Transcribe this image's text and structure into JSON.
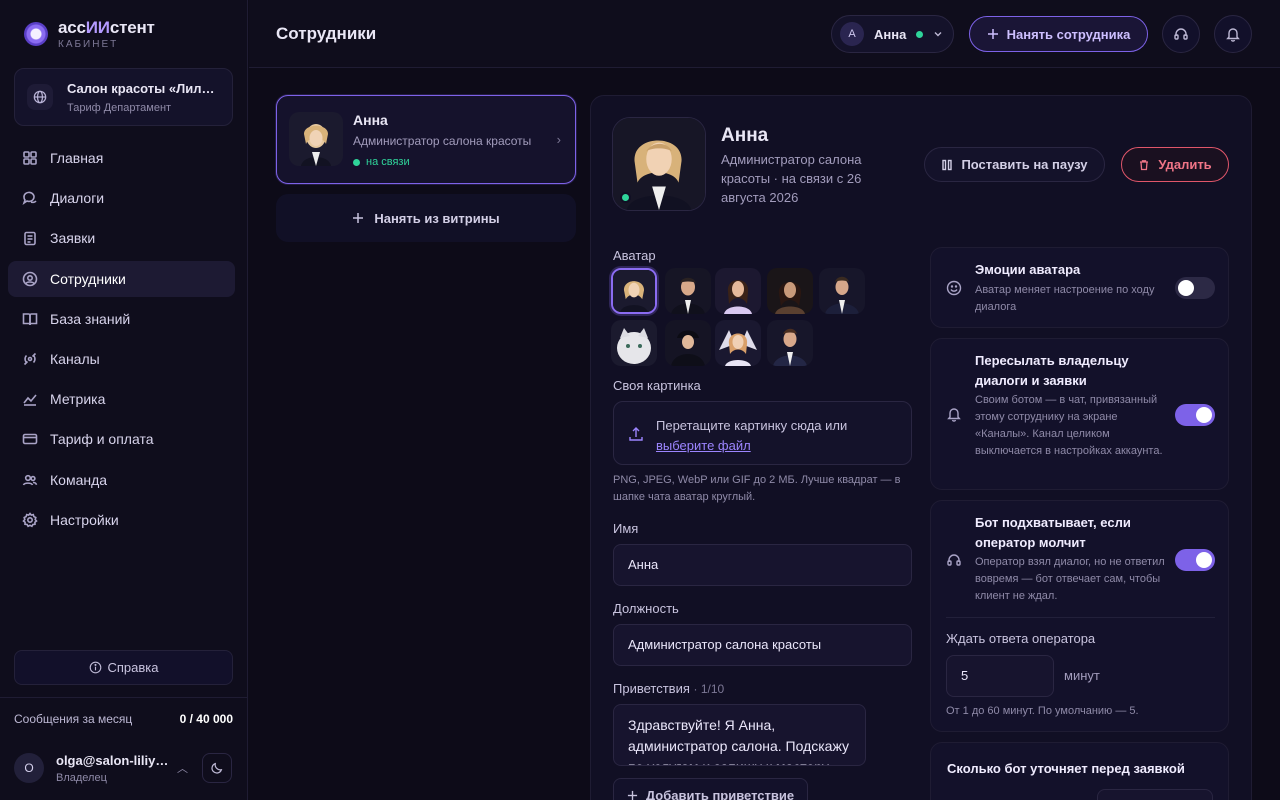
{
  "brand": {
    "name_pre": "асс",
    "name_hl": "ИИ",
    "name_post": "стент",
    "sub": "КАБИНЕТ"
  },
  "org": {
    "title": "Салон красоты «Лилия»",
    "plan": "Тариф Департамент"
  },
  "nav": [
    {
      "label": "Главная",
      "icon": "grid-icon"
    },
    {
      "label": "Диалоги",
      "icon": "chat-icon"
    },
    {
      "label": "Заявки",
      "icon": "clipboard-icon"
    },
    {
      "label": "Сотрудники",
      "icon": "user-circle-icon",
      "active": true
    },
    {
      "label": "База знаний",
      "icon": "book-icon"
    },
    {
      "label": "Каналы",
      "icon": "antenna-icon"
    },
    {
      "label": "Метрика",
      "icon": "chart-icon"
    },
    {
      "label": "Тариф и оплата",
      "icon": "card-icon"
    },
    {
      "label": "Команда",
      "icon": "team-icon"
    },
    {
      "label": "Настройки",
      "icon": "gear-icon"
    }
  ],
  "help_label": "Справка",
  "messages": {
    "label": "Сообщения за месяц",
    "value": "0 / 40 000"
  },
  "user": {
    "initial": "O",
    "email": "olga@salon-liliya.ru",
    "role": "Владелец"
  },
  "header": {
    "title": "Сотрудники",
    "selector": {
      "initial": "А",
      "name": "Анна"
    },
    "hire_label": "Нанять сотрудника"
  },
  "list": {
    "card": {
      "name": "Анна",
      "role": "Администратор салона красоты",
      "status": "на связи"
    },
    "hire_store": "Нанять из витрины"
  },
  "profile": {
    "name": "Анна",
    "subtitle": "Администратор салона красоты · на связи с 26 августа 2026",
    "pause_label": "Поставить на паузу",
    "delete_label": "Удалить"
  },
  "form": {
    "avatar_label": "Аватар",
    "custom_label": "Своя картинка",
    "drop_text": "Перетащите картинку сюда или",
    "drop_link": "выберите файл",
    "drop_hint": "PNG, JPEG, WebP или GIF до 2 МБ. Лучше квадрат — в шапке чата аватар круглый.",
    "name_label": "Имя",
    "name_value": "Анна",
    "position_label": "Должность",
    "position_value": "Администратор салона красоты",
    "greet_label": "Приветствия",
    "greet_count": "· 1/10",
    "greet_value": "Здравствуйте! Я Анна, администратор салона. Подскажу по услугам и запишу к мастеру.",
    "add_greet": "Добавить приветствие"
  },
  "settings": {
    "emotions": {
      "title": "Эмоции аватара",
      "desc": "Аватар меняет настроение по ходу диалога",
      "on": false
    },
    "forward": {
      "title": "Пересылать владельцу диалоги и заявки",
      "desc": "Своим ботом — в чат, привязанный этому сотруднику на экране «Каналы». Канал целиком выключается в настройках аккаунта.",
      "on": true
    },
    "takeover": {
      "title": "Бот подхватывает, если оператор молчит",
      "desc": "Оператор взял диалог, но не ответил вовремя — бот отвечает сам, чтобы клиент не ждал.",
      "on": true,
      "wait_label": "Ждать ответа оператора",
      "wait_value": "5",
      "wait_unit": "минут",
      "wait_hint": "От 1 до 60 минут. По умолчанию — 5."
    },
    "clarify": {
      "title": "Сколько бот уточняет перед заявкой"
    }
  },
  "colors": {
    "accent": "#7d62e8",
    "online": "#2fd49a",
    "danger": "#e0566a",
    "bg": "#0d0b18"
  }
}
